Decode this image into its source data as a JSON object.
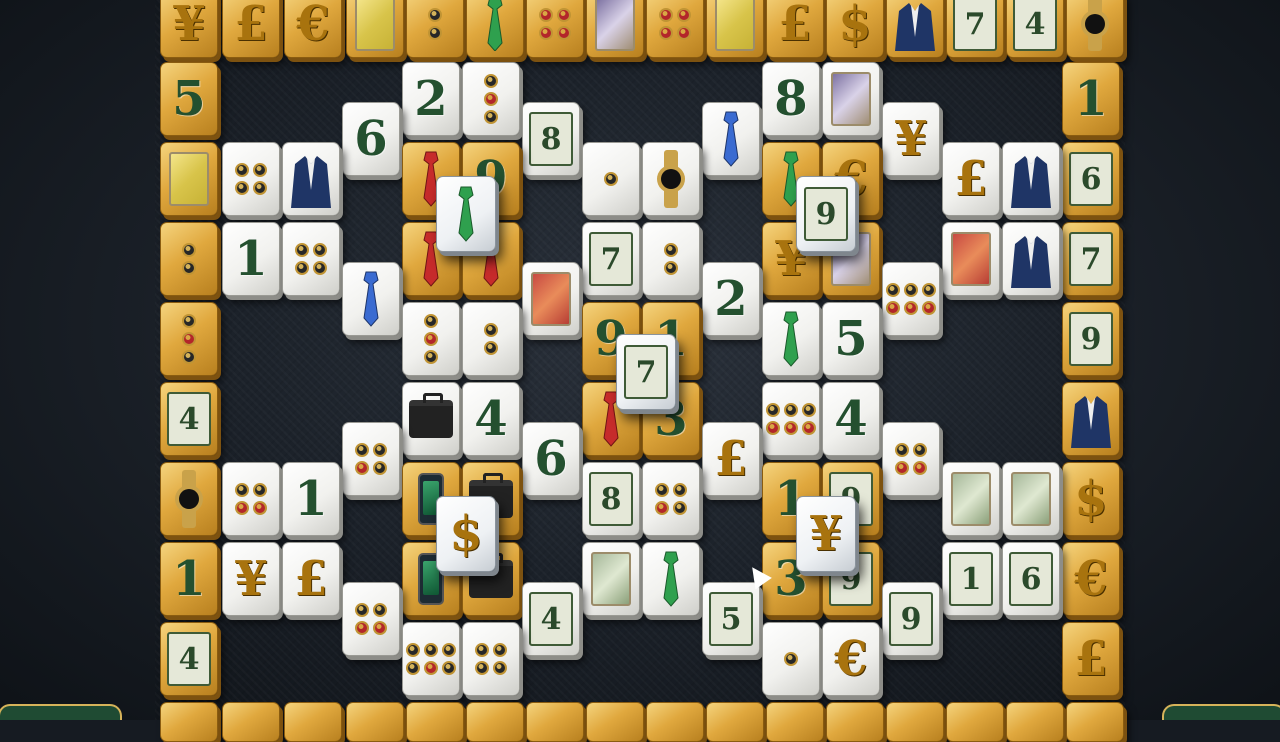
{
  "game": {
    "title": "",
    "tiles": [
      {
        "kind": "gold",
        "text": "¥",
        "color": "gold"
      },
      {
        "kind": "gold",
        "text": "£",
        "color": "gold"
      },
      {
        "kind": "gold",
        "text": "€",
        "color": "gold"
      },
      {
        "kind": "white",
        "text": "8",
        "color": "green"
      },
      {
        "kind": "white",
        "text": "4",
        "color": "green"
      },
      {
        "kind": "white",
        "text": "7",
        "color": "green"
      },
      {
        "kind": "white",
        "text": "1",
        "color": "green"
      },
      {
        "kind": "white",
        "text": "2",
        "color": "green"
      },
      {
        "kind": "white",
        "text": "6",
        "color": "green"
      },
      {
        "kind": "white",
        "text": "5",
        "color": "green"
      },
      {
        "kind": "white",
        "text": "9",
        "color": "green"
      },
      {
        "kind": "white",
        "text": "3",
        "color": "green"
      },
      {
        "kind": "gold",
        "text": "$",
        "color": "gold"
      }
    ],
    "colors": {
      "felt": "#1c222a",
      "gold_tile": "#e0a83e",
      "white_tile": "#f1f1ee",
      "digit_green": "#24502f",
      "symbol_gold": "#a8730e"
    }
  }
}
